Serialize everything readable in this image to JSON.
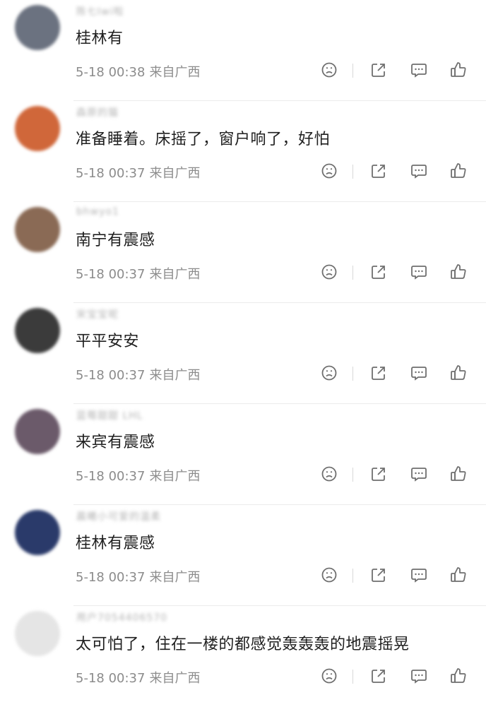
{
  "comments": [
    {
      "user": "陈七Iwi啦",
      "text": "桂林有",
      "date": "5-18 00:38",
      "location": "来自广西",
      "avatar_color": "#6b7280"
    },
    {
      "user": "森原的猫",
      "text": "准备睡着。床摇了，窗户响了，好怕",
      "date": "5-18 00:37",
      "location": "来自广西",
      "avatar_color": "#d0673a"
    },
    {
      "user": "bhwyo1",
      "text": "南宁有震感",
      "date": "5-18 00:37",
      "location": "来自广西",
      "avatar_color": "#8a6a55"
    },
    {
      "user": "宋宝宝呢",
      "text": "平平安安",
      "date": "5-18 00:37",
      "location": "来自广西",
      "avatar_color": "#3b3b3b"
    },
    {
      "user": "蓝莓甜甜 LHL",
      "text": "来宾有震感",
      "date": "5-18 00:37",
      "location": "来自广西",
      "avatar_color": "#6b5a6a"
    },
    {
      "user": "晨曦小可爱的温柔",
      "text": "桂林有震感",
      "date": "5-18 00:37",
      "location": "来自广西",
      "avatar_color": "#2a3a6a"
    },
    {
      "user": "用户7054406570",
      "text": "太可怕了，住在一楼的都感觉轰轰轰的地震摇晃",
      "date": "5-18 00:37",
      "location": "来自广西",
      "avatar_color": "#e5e5e5"
    }
  ],
  "icons": [
    "dislike-face-icon",
    "share-icon",
    "comment-icon",
    "like-thumb-icon"
  ]
}
